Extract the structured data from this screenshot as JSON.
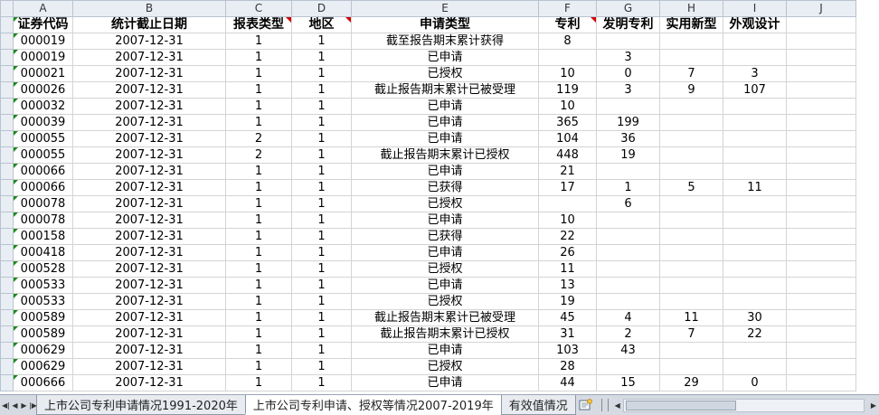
{
  "columns": [
    "",
    "A",
    "B",
    "C",
    "D",
    "E",
    "F",
    "G",
    "H",
    "I",
    "J"
  ],
  "header_row": [
    "证券代码",
    "统计截止日期",
    "报表类型",
    "地区",
    "申请类型",
    "专利",
    "发明专利",
    "实用新型",
    "外观设计",
    ""
  ],
  "rows": [
    [
      "000019",
      "2007-12-31",
      "1",
      "1",
      "截至报告期末累计获得",
      "8",
      "",
      "",
      "",
      ""
    ],
    [
      "000019",
      "2007-12-31",
      "1",
      "1",
      "已申请",
      "",
      "3",
      "",
      "",
      ""
    ],
    [
      "000021",
      "2007-12-31",
      "1",
      "1",
      "已授权",
      "10",
      "0",
      "7",
      "3",
      ""
    ],
    [
      "000026",
      "2007-12-31",
      "1",
      "1",
      "截止报告期末累计已被受理",
      "119",
      "3",
      "9",
      "107",
      ""
    ],
    [
      "000032",
      "2007-12-31",
      "1",
      "1",
      "已申请",
      "10",
      "",
      "",
      "",
      ""
    ],
    [
      "000039",
      "2007-12-31",
      "1",
      "1",
      "已申请",
      "365",
      "199",
      "",
      "",
      ""
    ],
    [
      "000055",
      "2007-12-31",
      "2",
      "1",
      "已申请",
      "104",
      "36",
      "",
      "",
      ""
    ],
    [
      "000055",
      "2007-12-31",
      "2",
      "1",
      "截止报告期末累计已授权",
      "448",
      "19",
      "",
      "",
      ""
    ],
    [
      "000066",
      "2007-12-31",
      "1",
      "1",
      "已申请",
      "21",
      "",
      "",
      "",
      ""
    ],
    [
      "000066",
      "2007-12-31",
      "1",
      "1",
      "已获得",
      "17",
      "1",
      "5",
      "11",
      ""
    ],
    [
      "000078",
      "2007-12-31",
      "1",
      "1",
      "已授权",
      "",
      "6",
      "",
      "",
      ""
    ],
    [
      "000078",
      "2007-12-31",
      "1",
      "1",
      "已申请",
      "10",
      "",
      "",
      "",
      ""
    ],
    [
      "000158",
      "2007-12-31",
      "1",
      "1",
      "已获得",
      "22",
      "",
      "",
      "",
      ""
    ],
    [
      "000418",
      "2007-12-31",
      "1",
      "1",
      "已申请",
      "26",
      "",
      "",
      "",
      ""
    ],
    [
      "000528",
      "2007-12-31",
      "1",
      "1",
      "已授权",
      "11",
      "",
      "",
      "",
      ""
    ],
    [
      "000533",
      "2007-12-31",
      "1",
      "1",
      "已申请",
      "13",
      "",
      "",
      "",
      ""
    ],
    [
      "000533",
      "2007-12-31",
      "1",
      "1",
      "已授权",
      "19",
      "",
      "",
      "",
      ""
    ],
    [
      "000589",
      "2007-12-31",
      "1",
      "1",
      "截止报告期末累计已被受理",
      "45",
      "4",
      "11",
      "30",
      ""
    ],
    [
      "000589",
      "2007-12-31",
      "1",
      "1",
      "截止报告期末累计已授权",
      "31",
      "2",
      "7",
      "22",
      ""
    ],
    [
      "000629",
      "2007-12-31",
      "1",
      "1",
      "已申请",
      "103",
      "43",
      "",
      "",
      ""
    ],
    [
      "000629",
      "2007-12-31",
      "1",
      "1",
      "已授权",
      "28",
      "",
      "",
      "",
      ""
    ],
    [
      "000666",
      "2007-12-31",
      "1",
      "1",
      "已申请",
      "44",
      "15",
      "29",
      "0",
      ""
    ]
  ],
  "sheet_tabs": [
    {
      "label": "上市公司专利申请情况1991-2020年",
      "active": false
    },
    {
      "label": "上市公司专利申请、授权等情况2007-2019年",
      "active": true
    },
    {
      "label": "有效值情况",
      "active": false
    }
  ],
  "icons": {
    "first_sheet": "first-sheet-icon",
    "prev_sheet": "prev-sheet-icon",
    "next_sheet": "next-sheet-icon",
    "last_sheet": "last-sheet-icon",
    "new_sheet": "new-sheet-icon"
  },
  "colors": {
    "text_marker": "#1a8a1a",
    "comment_marker": "#d00000",
    "header_bg": "#e9eef4"
  }
}
